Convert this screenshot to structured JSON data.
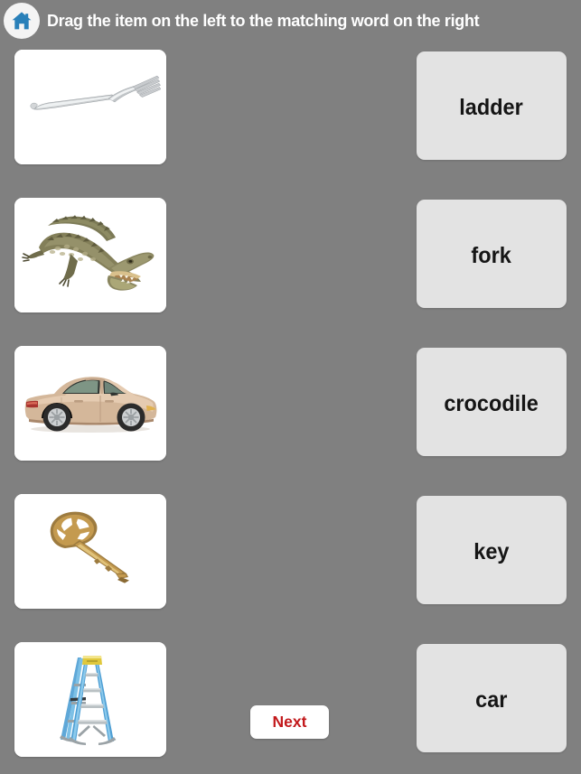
{
  "header": {
    "home_icon": "home-icon",
    "instruction": "Drag the item on the left to the matching word on the right"
  },
  "colors": {
    "background": "#808080",
    "picture_card": "#ffffff",
    "word_card": "#e3e3e3",
    "word_text": "#151515",
    "header_text": "#ffffff",
    "home_icon": "#2980b9",
    "next_text": "#c2181b",
    "next_background": "#ffffff"
  },
  "picture_cards": [
    {
      "name": "fork",
      "icon": "fork-image",
      "alt": "silver dinner fork on white background"
    },
    {
      "name": "crocodile",
      "icon": "crocodile-image",
      "alt": "green brown crocodile with open mouth"
    },
    {
      "name": "car",
      "icon": "car-image",
      "alt": "beige sedan car side view"
    },
    {
      "name": "key",
      "icon": "key-image",
      "alt": "brass door key angled"
    },
    {
      "name": "ladder",
      "icon": "ladder-image",
      "alt": "blue step ladder with yellow top"
    }
  ],
  "word_cards": [
    {
      "label": "ladder"
    },
    {
      "label": "fork"
    },
    {
      "label": "crocodile"
    },
    {
      "label": "key"
    },
    {
      "label": "car"
    }
  ],
  "next_button": {
    "label": "Next"
  }
}
